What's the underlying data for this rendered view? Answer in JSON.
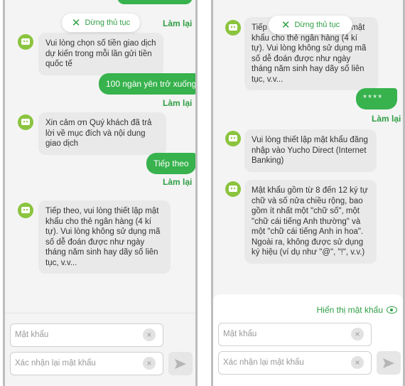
{
  "stop_button_label": "Dừng thủ tục",
  "redo_label": "Làm lại",
  "left_panel": {
    "messages": {
      "bot_1": "Vui lòng chọn số tiền giao dịch dự kiến trong mỗi lần gửi tiền quốc tế",
      "user_1": "100 ngàn yên trở xuống",
      "bot_2": "Xin cảm ơn Quý khách đã trả lời về mục đích và nội dung giao dịch",
      "user_2": "Tiếp theo",
      "bot_3": "Tiếp theo, vui lòng thiết lập mật khẩu cho thẻ ngân hàng (4 kí tự). Vui lòng không sử dụng mã số dễ đoán được như ngày tháng năm sinh hay dãy số liên tục, v.v..."
    },
    "password_placeholder": "Mật khẩu",
    "confirm_placeholder": "Xác nhận lại mật khẩu"
  },
  "right_panel": {
    "messages": {
      "bot_1": "Tiếp theo, vui lòng thiết lập mật khẩu cho thẻ ngân hàng (4 kí tự). Vui lòng không sử dụng mã số dễ đoán được như ngày tháng năm sinh hay dãy số liên tục, v.v...",
      "user_1": "****",
      "bot_2": "Vui lòng thiết lập mật khẩu đăng nhập vào Yucho Direct (Internet Banking)",
      "bot_3": "Mật khẩu gồm từ 8 đến 12 ký tự chữ và số nửa chiều rộng, bao gồm ít nhất một \"chữ số\", một \"chữ cái tiếng Anh thường\" và một \"chữ cái tiếng Anh in hoa\". Ngoài ra, không được sử dụng ký hiệu (ví dụ như \"@\", \"!\", v.v.)"
    },
    "show_password_label": "Hiển thị mật khẩu",
    "password_placeholder": "Mật khẩu",
    "confirm_placeholder": "Xác nhận lại mật khẩu"
  },
  "clear_glyph": "×",
  "icons": [
    "bot-avatar-icon",
    "close-icon",
    "clear-icon",
    "send-icon",
    "eye-icon"
  ],
  "colors": {
    "accent": "#37b24d",
    "accent_text": "#2f9e44",
    "bot_bubble": "#e9e9e9",
    "background": "#f4f4f4"
  }
}
